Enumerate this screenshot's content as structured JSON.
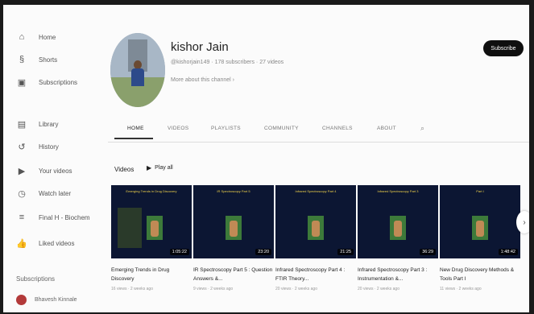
{
  "sidebar": {
    "items": [
      {
        "label": "Home",
        "icon": "home-icon",
        "glyph": "⌂"
      },
      {
        "label": "Shorts",
        "icon": "shorts-icon",
        "glyph": "§"
      },
      {
        "label": "Subscriptions",
        "icon": "subscriptions-icon",
        "glyph": "▣"
      },
      {
        "label": "Library",
        "icon": "library-icon",
        "glyph": "▤"
      },
      {
        "label": "History",
        "icon": "history-icon",
        "glyph": "↺"
      },
      {
        "label": "Your videos",
        "icon": "your-videos-icon",
        "glyph": "▶"
      },
      {
        "label": "Watch later",
        "icon": "watch-later-icon",
        "glyph": "◷"
      },
      {
        "label": "Final H - Biochem",
        "icon": "playlist-icon",
        "glyph": "≡"
      },
      {
        "label": "Liked videos",
        "icon": "liked-videos-icon",
        "glyph": "👍"
      }
    ],
    "subscriptions_title": "Subscriptions",
    "subscription": {
      "label": "Bhavesh Kinnale"
    }
  },
  "channel": {
    "name": "kishor Jain",
    "handle": "@kishorjain149 · 178 subscribers · 27 videos",
    "more": "More about this channel  ›",
    "subscribe_label": "Subscribe"
  },
  "tabs": [
    {
      "label": "HOME",
      "active": true
    },
    {
      "label": "VIDEOS",
      "active": false
    },
    {
      "label": "PLAYLISTS",
      "active": false
    },
    {
      "label": "COMMUNITY",
      "active": false
    },
    {
      "label": "CHANNELS",
      "active": false
    },
    {
      "label": "ABOUT",
      "active": false
    }
  ],
  "videos_section": {
    "title": "Videos",
    "play_all": "Play all"
  },
  "videos": [
    {
      "title": "Emerging Trends in Drug Discovery",
      "duration": "1:05:22",
      "meta": "16 views · 2 weeks ago",
      "thumb_header": "Emerging Trends in Drug Discovery"
    },
    {
      "title": "IR Spectroscopy Part 5 : Question Answers &...",
      "duration": "23:20",
      "meta": "9 views · 2 weeks ago",
      "thumb_header": "IR Spectroscopy Part 5"
    },
    {
      "title": "Infrared Spectroscopy Part 4 : FTIR Theory...",
      "duration": "21:25",
      "meta": "20 views · 2 weeks ago",
      "thumb_header": "Infrared Spectroscopy Part 4"
    },
    {
      "title": "Infrared Spectroscopy Part 3 : Instrumentation &...",
      "duration": "36:29",
      "meta": "20 views · 2 weeks ago",
      "thumb_header": "Infrared Spectroscopy Part 3"
    },
    {
      "title": "New Drug Discovery Methods & Tools Part I",
      "duration": "1:48:42",
      "meta": "11 views · 2 weeks ago",
      "thumb_header": "Part I"
    }
  ],
  "colors": {
    "subscribe_bg": "#0f0f0f",
    "thumb_bg": "#0c1633",
    "accent": "#f0d24a"
  }
}
